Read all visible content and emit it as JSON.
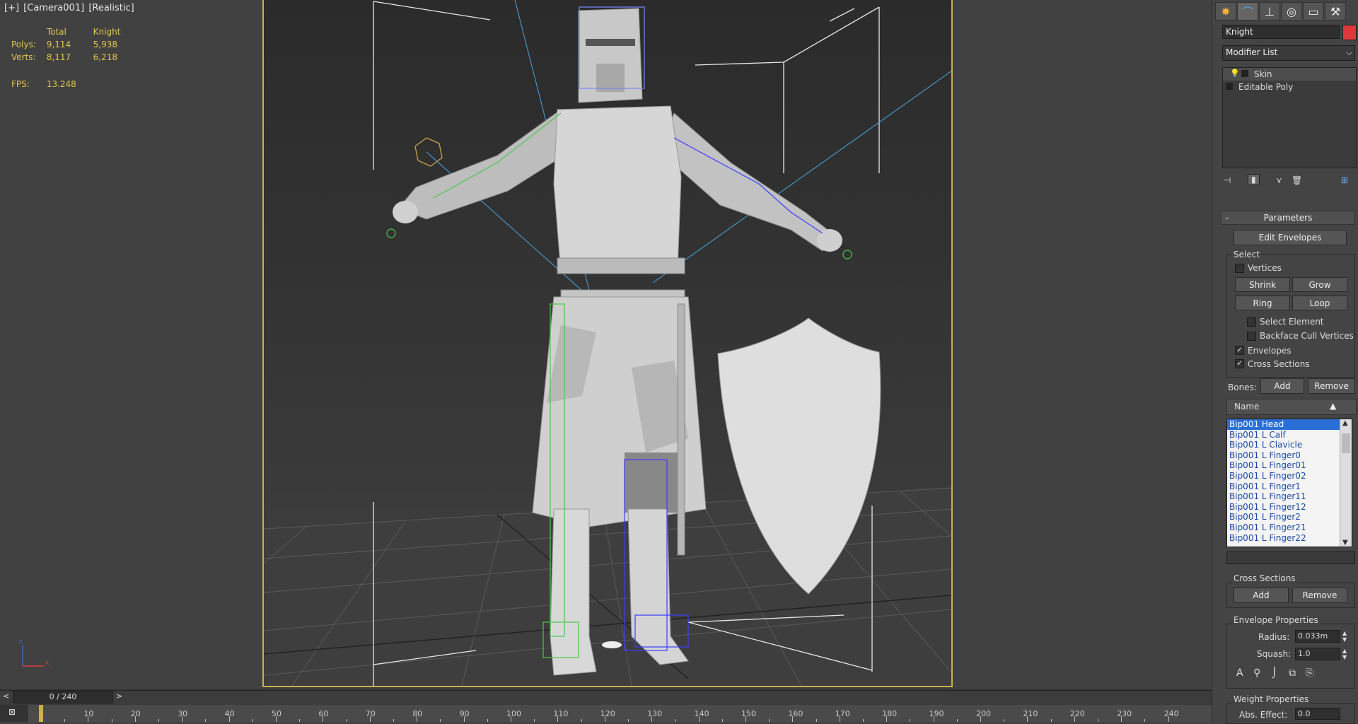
{
  "viewport": {
    "label": [
      "[+]",
      "[Camera001]",
      "[Realistic]"
    ],
    "stats": {
      "headers": [
        "Total",
        "Knight"
      ],
      "rows": [
        {
          "label": "Polys:",
          "total": "9,114",
          "object": "5,938"
        },
        {
          "label": "Verts:",
          "total": "8,117",
          "object": "6,218"
        }
      ],
      "fps_label": "FPS:",
      "fps_value": "13.248"
    },
    "axis": {
      "x": "x",
      "y": "y",
      "z": "z"
    }
  },
  "command_panel": {
    "tabs": [
      "create-icon",
      "modify-icon",
      "hierarchy-icon",
      "motion-icon",
      "display-icon",
      "utilities-icon"
    ],
    "object_name": "Knight",
    "object_color": "#e0373a",
    "modifier_list": "Modifier List",
    "stack": [
      "Skin",
      "Editable Poly"
    ],
    "stack_tools": [
      "pin-stack-icon",
      "show-end-result-icon",
      "make-unique-icon",
      "remove-modifier-icon",
      "configure-sets-icon"
    ],
    "parameters": {
      "title": "Parameters",
      "collapse": "-",
      "edit_envelopes": "Edit Envelopes",
      "select": {
        "title": "Select",
        "vertices": "Vertices",
        "shrink": "Shrink",
        "grow": "Grow",
        "ring": "Ring",
        "loop": "Loop",
        "select_element": "Select Element",
        "backface": "Backface Cull Vertices",
        "envelopes": "Envelopes",
        "cross_sections": "Cross Sections"
      },
      "bones_label": "Bones:",
      "add": "Add",
      "remove": "Remove",
      "name_header": "Name",
      "bones": [
        "Bip001 Head",
        "Bip001 L Calf",
        "Bip001 L Clavicle",
        "Bip001 L Finger0",
        "Bip001 L Finger01",
        "Bip001 L Finger02",
        "Bip001 L Finger1",
        "Bip001 L Finger11",
        "Bip001 L Finger12",
        "Bip001 L Finger2",
        "Bip001 L Finger21",
        "Bip001 L Finger22"
      ],
      "cross_sections_title": "Cross Sections",
      "cs_add": "Add",
      "cs_remove": "Remove",
      "envelope_props_title": "Envelope Properties",
      "radius_label": "Radius:",
      "radius_value": "0.033m",
      "squash_label": "Squash:",
      "squash_value": "1.0",
      "weight_props_title": "Weight Properties",
      "abs_effect_label": "Abs. Effect:",
      "abs_effect_value": "0.0"
    }
  },
  "timeline": {
    "frame": "0 / 240",
    "ticks": [
      "10",
      "20",
      "30",
      "40",
      "50",
      "60",
      "70",
      "80",
      "90",
      "100",
      "110",
      "120",
      "130",
      "140",
      "150",
      "160",
      "170",
      "180",
      "190",
      "200",
      "210",
      "220",
      "230",
      "240"
    ]
  }
}
